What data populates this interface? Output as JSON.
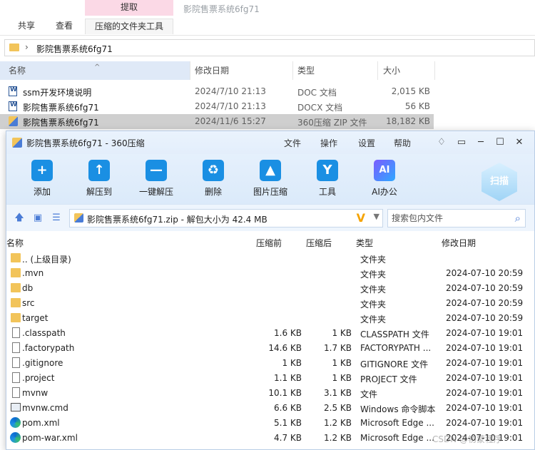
{
  "ribbon": {
    "context_label": "提取",
    "tabs": [
      "共享",
      "查看",
      "压缩的文件夹工具"
    ],
    "hint": "影院售票系统6fg71"
  },
  "address": {
    "path": "影院售票系统6fg71"
  },
  "explorer": {
    "columns": [
      "名称",
      "修改日期",
      "类型",
      "大小"
    ],
    "files": [
      {
        "name": "ssm开发环境说明",
        "date": "2024/7/10 21:13",
        "type": "DOC 文档",
        "size": "2,015 KB",
        "icon": "word-doc-icon"
      },
      {
        "name": "影院售票系统6fg71",
        "date": "2024/7/10 21:13",
        "type": "DOCX 文档",
        "size": "56 KB",
        "icon": "word-doc-icon"
      },
      {
        "name": "影院售票系统6fg71",
        "date": "2024/11/6 15:27",
        "type": "360压缩 ZIP 文件",
        "size": "18,182 KB",
        "icon": "zip-icon",
        "selected": true
      }
    ]
  },
  "window": {
    "title": "影院售票系统6fg71 - 360压缩",
    "menu": [
      "文件",
      "操作",
      "设置",
      "帮助"
    ],
    "tools": [
      {
        "label": "添加",
        "glyph": "+"
      },
      {
        "label": "解压到",
        "glyph": "↑"
      },
      {
        "label": "一键解压",
        "glyph": "—"
      },
      {
        "label": "删除",
        "glyph": "♻"
      },
      {
        "label": "图片压缩",
        "glyph": "▲"
      },
      {
        "label": "工具",
        "glyph": "Y"
      },
      {
        "label": "AI办公",
        "glyph": "AI"
      }
    ],
    "scan_label": "扫描",
    "path_text": "影院售票系统6fg71.zip - 解包大小为 42.4 MB",
    "search_placeholder": "搜索包内文件",
    "list_columns": [
      "名称",
      "压缩前",
      "压缩后",
      "类型",
      "修改日期"
    ],
    "entries": [
      {
        "name": ".. (上级目录)",
        "before": "",
        "after": "",
        "type": "文件夹",
        "date": "",
        "icon": "folder-icon"
      },
      {
        "name": ".mvn",
        "before": "",
        "after": "",
        "type": "文件夹",
        "date": "2024-07-10 20:59",
        "icon": "folder-icon"
      },
      {
        "name": "db",
        "before": "",
        "after": "",
        "type": "文件夹",
        "date": "2024-07-10 20:59",
        "icon": "folder-icon"
      },
      {
        "name": "src",
        "before": "",
        "after": "",
        "type": "文件夹",
        "date": "2024-07-10 20:59",
        "icon": "folder-icon"
      },
      {
        "name": "target",
        "before": "",
        "after": "",
        "type": "文件夹",
        "date": "2024-07-10 20:59",
        "icon": "folder-icon"
      },
      {
        "name": ".classpath",
        "before": "1.6 KB",
        "after": "1 KB",
        "type": "CLASSPATH 文件",
        "date": "2024-07-10 19:01",
        "icon": "file-icon"
      },
      {
        "name": ".factorypath",
        "before": "14.6 KB",
        "after": "1.7 KB",
        "type": "FACTORYPATH ...",
        "date": "2024-07-10 19:01",
        "icon": "file-icon"
      },
      {
        "name": ".gitignore",
        "before": "1 KB",
        "after": "1 KB",
        "type": "GITIGNORE 文件",
        "date": "2024-07-10 19:01",
        "icon": "file-icon"
      },
      {
        "name": ".project",
        "before": "1.1 KB",
        "after": "1 KB",
        "type": "PROJECT 文件",
        "date": "2024-07-10 19:01",
        "icon": "file-icon"
      },
      {
        "name": "mvnw",
        "before": "10.1 KB",
        "after": "3.1 KB",
        "type": "文件",
        "date": "2024-07-10 19:01",
        "icon": "file-icon"
      },
      {
        "name": "mvnw.cmd",
        "before": "6.6 KB",
        "after": "2.5 KB",
        "type": "Windows 命令脚本",
        "date": "2024-07-10 19:01",
        "icon": "cmd-icon"
      },
      {
        "name": "pom.xml",
        "before": "5.1 KB",
        "after": "1.2 KB",
        "type": "Microsoft Edge ...",
        "date": "2024-07-10 19:01",
        "icon": "edge-icon"
      },
      {
        "name": "pom-war.xml",
        "before": "4.7 KB",
        "after": "1.2 KB",
        "type": "Microsoft Edge ...",
        "date": "2024-07-10 19:01",
        "icon": "edge-icon"
      }
    ]
  },
  "watermark": "CSDN @初蒙程序"
}
